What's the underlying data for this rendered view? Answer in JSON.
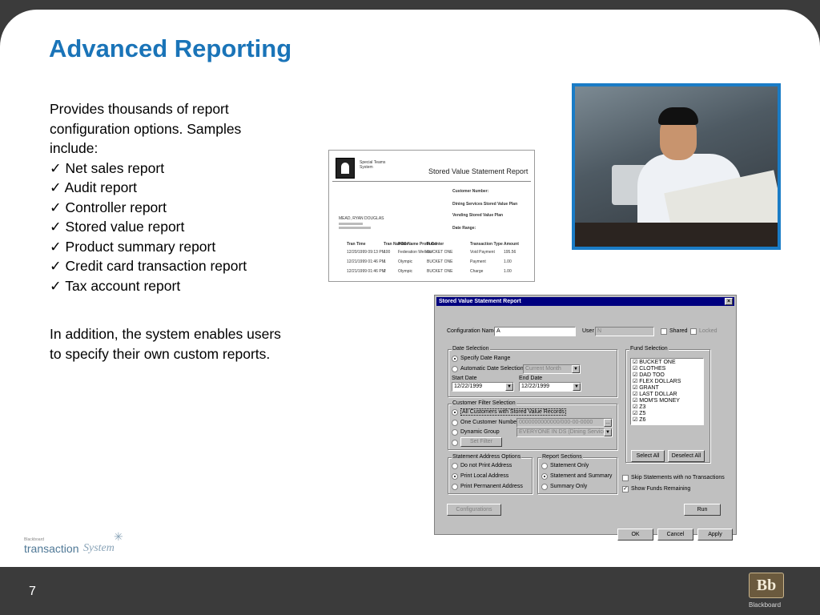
{
  "slide": {
    "title": "Advanced Reporting",
    "intro": "Provides thousands of report configuration options.  Samples include:",
    "samples": [
      "Net sales report",
      "Audit report",
      "Controller report",
      "Stored value report",
      "Product summary report",
      "Credit card transaction report",
      "Tax account report"
    ],
    "closing": "In addition, the system enables users to specify their own custom reports.",
    "page_number": "7"
  },
  "report_thumbnail": {
    "org_line1": "Special Teams",
    "org_line2": "System",
    "title": "Stored Value Statement Report",
    "customer_label": "Customer Number:",
    "plan_label": "Dining Services Stored Value Plan",
    "vending_label": "Vending Stored Value Plan",
    "date_range_label": "Date Range:",
    "name": "MEAD, RYAN DOUGLAS",
    "columns": [
      "Tran Time",
      "Tran Number",
      "POS Name Profit Center",
      "Fund",
      "Transaction Type",
      "Amount"
    ],
    "rows": [
      [
        "12/20/1999 09:13 PM",
        "100",
        "Federation Welless",
        "BUCKET ONE",
        "Void Payment",
        "195.56"
      ],
      [
        "12/21/1999 01:46 PM",
        "1",
        "Olympic",
        "BUCKET ONE",
        "Payment",
        "1.00"
      ],
      [
        "12/21/1999 01:46 PM",
        "2",
        "Olympic",
        "BUCKET ONE",
        "Charge",
        "1.00"
      ]
    ]
  },
  "dialog": {
    "title": "Stored Value Statement Report",
    "close_glyph": "×",
    "configuration_name_label": "Configuration Name",
    "configuration_name_value": "A",
    "user_label": "User",
    "user_value": "N",
    "shared_label": "Shared",
    "locked_label": "Locked",
    "date_selection": {
      "label": "Date Selection",
      "specify_date_range": "Specify Date Range",
      "automatic_date_selection": "Automatic Date Selection",
      "automatic_value": "Current Month",
      "start_date_label": "Start Date",
      "start_date_value": "12/22/1999",
      "end_date_label": "End Date",
      "end_date_value": "12/22/1999"
    },
    "fund_selection": {
      "label": "Fund Selection",
      "items": [
        "BUCKET ONE",
        "CLOTHES",
        "DAD TOO",
        "FLEX DOLLARS",
        "GRANT",
        "LAST DOLLAR",
        "MOM'S MONEY",
        "Z3",
        "Z5",
        "Z6"
      ],
      "select_all": "Select All",
      "deselect_all": "Deselect All"
    },
    "customer_filter": {
      "label": "Customer Filter Selection",
      "all_customers": "All Customers with Stored Value Records",
      "one_customer": "One Customer Number",
      "one_customer_value": "0000000000000/000-00-0000",
      "dynamic_group": "Dynamic Group",
      "dynamic_group_value": "EVERYONE IN DS (Dining Services)",
      "set_filter": "Set Filter"
    },
    "statement_address": {
      "label": "Statement Address Options",
      "do_not_print": "Do not Print Address",
      "print_local": "Print Local Address",
      "print_permanent": "Print Permanent Address"
    },
    "report_sections": {
      "label": "Report Sections",
      "statement_only": "Statement Only",
      "statement_and_summary": "Statement and Summary",
      "summary_only": "Summary Only"
    },
    "skip_statements": "Skip Statements with no Transactions",
    "show_funds_remaining": "Show Funds Remaining",
    "configurations_button": "Configurations",
    "run_button": "Run",
    "ok_button": "OK",
    "cancel_button": "Cancel",
    "apply_button": "Apply"
  },
  "footer": {
    "ts_small": "Blackboard",
    "ts_main": "transaction",
    "ts_system": "System",
    "bb_logo": "Bb",
    "bb_text": "Blackboard"
  },
  "colors": {
    "title": "#1a74b8",
    "frame": "#3b3b3b",
    "dialog_titlebar": "#00007f"
  }
}
